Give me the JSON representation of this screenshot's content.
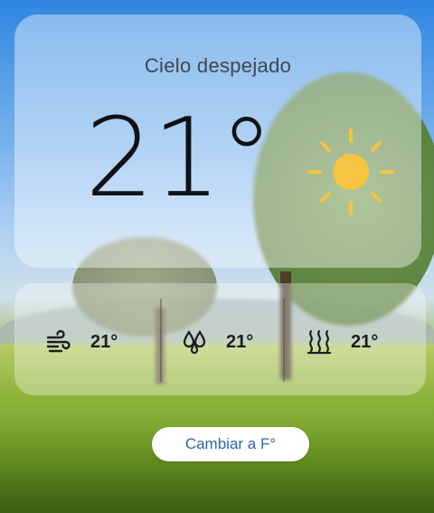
{
  "weather": {
    "condition": "Cielo despejado",
    "temperature": "21°",
    "icon": "sun-icon"
  },
  "details": [
    {
      "icon": "wind-icon",
      "value": "21°"
    },
    {
      "icon": "humidity-drops-icon",
      "value": "21°"
    },
    {
      "icon": "heat-waves-icon",
      "value": "21°"
    }
  ],
  "actions": {
    "toggle_unit_label": "Cambiar a F°"
  },
  "colors": {
    "sun": "#f6c440",
    "button_text": "#2f67a8"
  }
}
